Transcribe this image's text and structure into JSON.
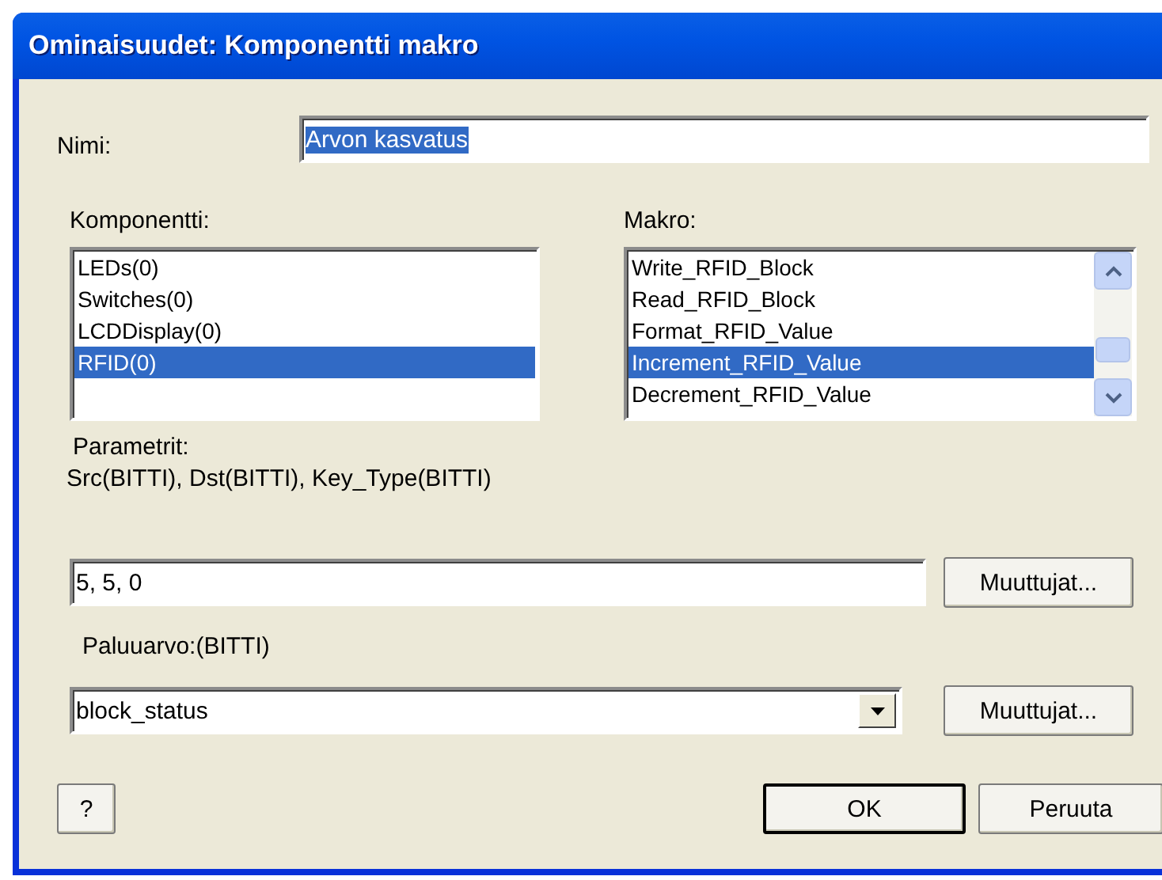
{
  "window": {
    "title": "Ominaisuudet: Komponentti makro"
  },
  "name_field": {
    "label": "Nimi:",
    "value": "Arvon kasvatus",
    "text_selected": true
  },
  "component_list": {
    "label": "Komponentti:",
    "items": [
      {
        "label": "LEDs(0)",
        "selected": false
      },
      {
        "label": "Switches(0)",
        "selected": false
      },
      {
        "label": "LCDDisplay(0)",
        "selected": false
      },
      {
        "label": "RFID(0)",
        "selected": true
      }
    ]
  },
  "macro_list": {
    "label": "Makro:",
    "items": [
      {
        "label": "Write_RFID_Block",
        "selected": false
      },
      {
        "label": "Read_RFID_Block",
        "selected": false
      },
      {
        "label": "Format_RFID_Value",
        "selected": false
      },
      {
        "label": "Increment_RFID_Value",
        "selected": true
      },
      {
        "label": "Decrement_RFID_Value",
        "selected": false
      }
    ]
  },
  "parameters": {
    "label": "Parametrit:",
    "signature": "Src(BITTI), Dst(BITTI), Key_Type(BITTI)",
    "value": "5, 5, 0",
    "button": "Muuttujat..."
  },
  "return_value": {
    "label": "Paluuarvo:(BITTI)",
    "value": "block_status",
    "button": "Muuttujat..."
  },
  "buttons": {
    "help": "?",
    "ok": "OK",
    "cancel": "Peruuta"
  }
}
